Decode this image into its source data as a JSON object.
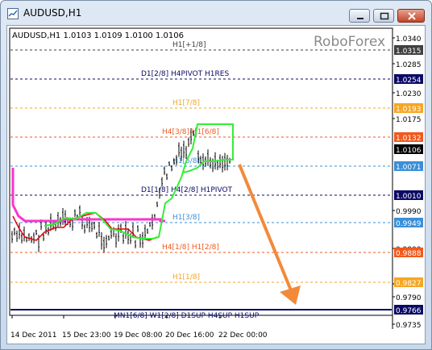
{
  "window": {
    "title": "AUDUSD,H1"
  },
  "header": {
    "quote": "AUDUSD,H1  1.0103 1.0109 1.0100 1.0106",
    "watermark": "RoboForex"
  },
  "price_scale": [
    {
      "label": "1.0340",
      "boxed": false
    },
    {
      "label": "1.0315",
      "boxed": true,
      "bg": "#404040"
    },
    {
      "label": "1.0285",
      "boxed": false
    },
    {
      "label": "1.0254",
      "boxed": true,
      "bg": "#0a0a66"
    },
    {
      "label": "1.0230",
      "boxed": false
    },
    {
      "label": "1.0193",
      "boxed": true,
      "bg": "#f6a623"
    },
    {
      "label": "1.0175",
      "boxed": false
    },
    {
      "label": "1.0132",
      "boxed": true,
      "bg": "#f05a1e"
    },
    {
      "label": "1.0106",
      "boxed": true,
      "bg": "#000000"
    },
    {
      "label": "1.0071",
      "boxed": true,
      "bg": "#3a8fd8"
    },
    {
      "label": "1.0010",
      "boxed": true,
      "bg": "#0a0a66"
    },
    {
      "label": "0.9990",
      "boxed": false
    },
    {
      "label": "0.9949",
      "boxed": true,
      "bg": "#3a8fd8"
    },
    {
      "label": "0.9900",
      "boxed": false
    },
    {
      "label": "0.9888",
      "boxed": true,
      "bg": "#f05a1e"
    },
    {
      "label": "0.9845",
      "boxed": false
    },
    {
      "label": "0.9827",
      "boxed": true,
      "bg": "#f6a623"
    },
    {
      "label": "0.9790",
      "boxed": false
    },
    {
      "label": "0.9766",
      "boxed": true,
      "bg": "#0a0a66"
    },
    {
      "label": "0.9735",
      "boxed": false
    }
  ],
  "levels": [
    {
      "label": "H1[+1/8]",
      "price": 1.0315,
      "color": "#404040"
    },
    {
      "label": "D1[2/8] H4PIVOT H1RES",
      "price": 1.0254,
      "color": "#0a0a66"
    },
    {
      "label": "H1[7/8]",
      "price": 1.0193,
      "color": "#f6a623"
    },
    {
      "label": "H4[3/8] H1[6/8]",
      "price": 1.0132,
      "color": "#f05a1e"
    },
    {
      "label": "H1[5/8]",
      "price": 1.0071,
      "color": "#3a8fd8"
    },
    {
      "label": "D1[1/8] H4[2/8] H1PIVOT",
      "price": 1.001,
      "color": "#0a0a66"
    },
    {
      "label": "H1[3/8]",
      "price": 0.9949,
      "color": "#3a8fd8"
    },
    {
      "label": "H4[1/8] H1[2/8]",
      "price": 0.9888,
      "color": "#f05a1e"
    },
    {
      "label": "H1[1/8]",
      "price": 0.9827,
      "color": "#f6a623"
    },
    {
      "label": "MN1[6/8] W1[2/8] D1SUP H4SUP H1SUP",
      "price": 0.9766,
      "color": "#0a0a66"
    }
  ],
  "time_axis": [
    "14 Dec 2011",
    "15 Dec 23:00",
    "19 Dec 08:00",
    "20 Dec 16:00",
    "22 Dec 00:00"
  ],
  "colors": {
    "magenta_line": "#ff33cc",
    "red_line": "#e8000b",
    "green_line": "#33ee33",
    "arrow": "#f28a3a"
  },
  "icons": {
    "app": "chart-window-icon",
    "minimize": "minimize-icon",
    "maximize": "maximize-icon",
    "close": "close-icon"
  }
}
